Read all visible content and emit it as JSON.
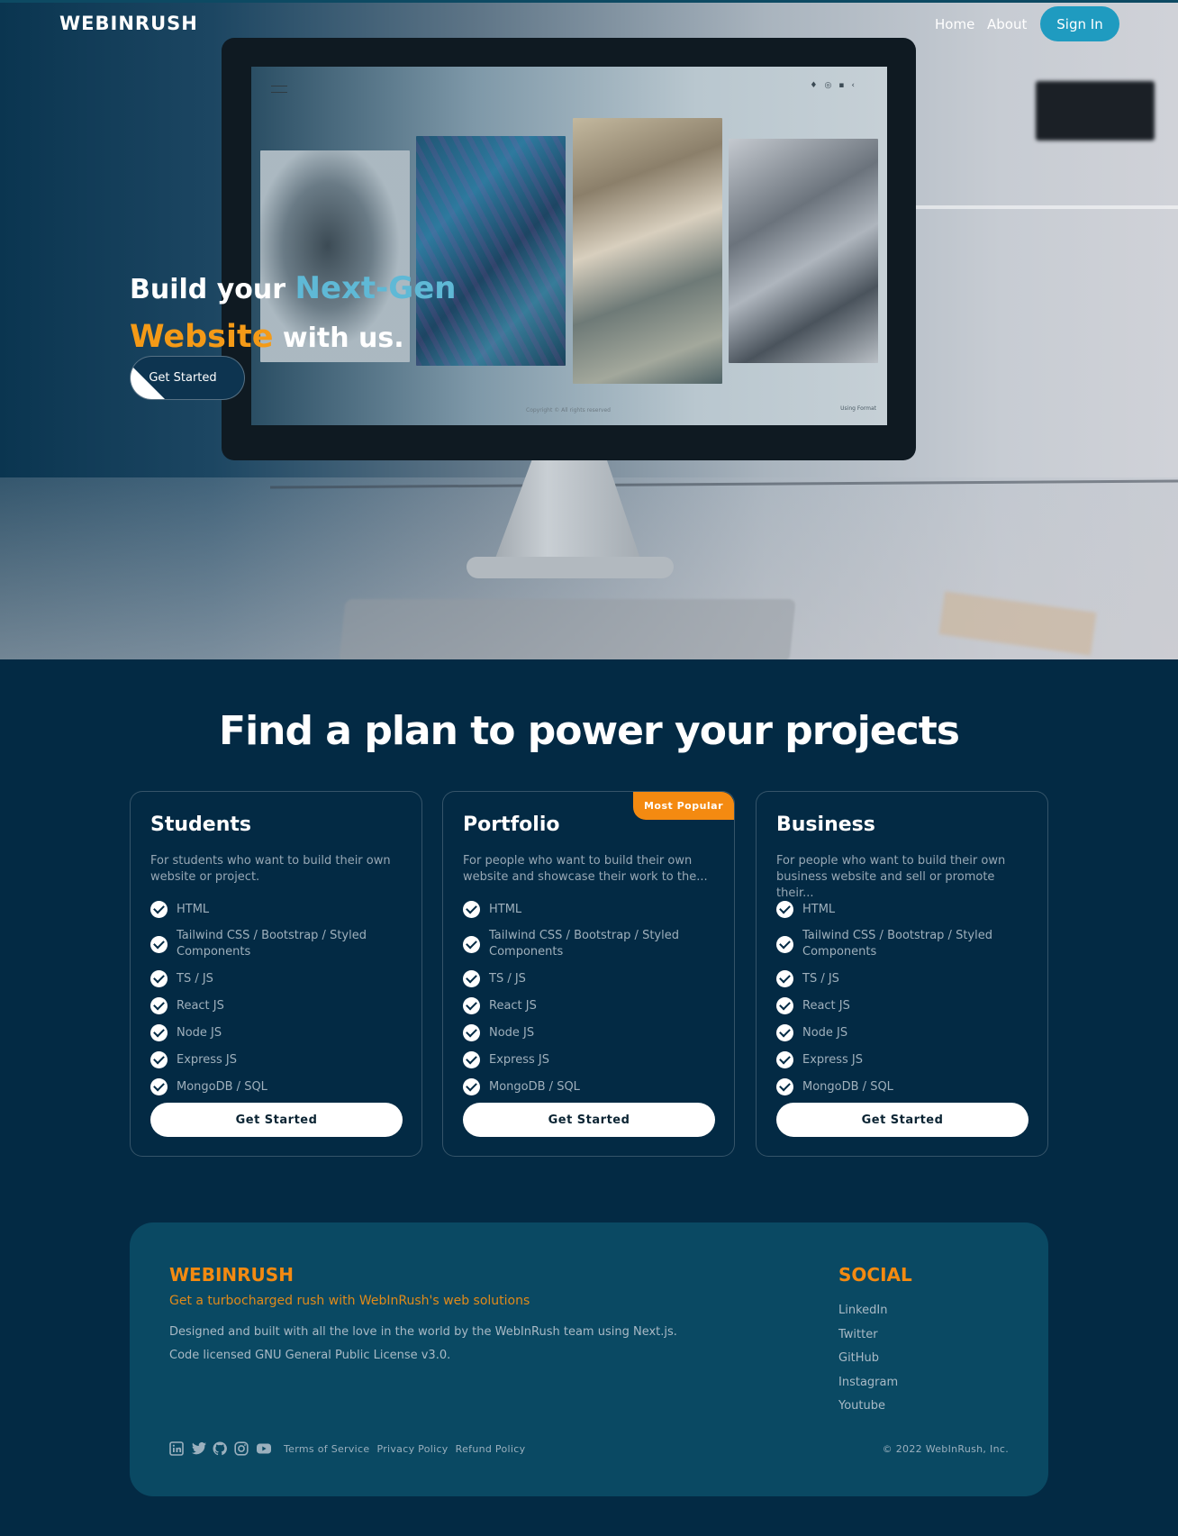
{
  "nav": {
    "logo": "WEBINRUSH",
    "links": [
      "Home",
      "About"
    ],
    "signin": "Sign In"
  },
  "hero": {
    "line1_a": "Build your ",
    "line1_b": "Next-Gen",
    "line2_a": "Website",
    "line2_b": " with us.",
    "cta": "Get Started",
    "screen_copy": "Copyright © All rights reserved",
    "screen_using": "Using Format"
  },
  "plans": {
    "title": "Find a plan to power your projects",
    "badge": "Most Popular",
    "cards": [
      {
        "name": "Students",
        "desc": "For students who want to build their own website or project.",
        "features": [
          "HTML",
          "Tailwind CSS / Bootstrap / Styled Components",
          "TS / JS",
          "React JS",
          "Node JS",
          "Express JS",
          "MongoDB / SQL"
        ],
        "button": "Get Started"
      },
      {
        "name": "Portfolio",
        "desc": "For people who want to build their own website and showcase their work to the...",
        "features": [
          "HTML",
          "Tailwind CSS / Bootstrap / Styled Components",
          "TS / JS",
          "React JS",
          "Node JS",
          "Express JS",
          "MongoDB / SQL"
        ],
        "button": "Get Started"
      },
      {
        "name": "Business",
        "desc": "For people who want to build their own business website and sell or promote their...",
        "features": [
          "HTML",
          "Tailwind CSS / Bootstrap / Styled Components",
          "TS / JS",
          "React JS",
          "Node JS",
          "Express JS",
          "MongoDB / SQL"
        ],
        "button": "Get Started"
      }
    ]
  },
  "footer": {
    "logo": "WEBINRUSH",
    "tagline": "Get a turbocharged rush with WebInRush's web solutions",
    "line1": "Designed and built with all the love in the world by the WebInRush team using Next.js.",
    "line2": "Code licensed GNU General Public License v3.0.",
    "social_title": "SOCIAL",
    "social_links": [
      "LinkedIn",
      "Twitter",
      "GitHub",
      "Instagram",
      "Youtube"
    ],
    "icons": [
      "linkedin-icon",
      "twitter-icon",
      "github-icon",
      "instagram-icon",
      "youtube-icon"
    ],
    "bottom_links": [
      "Terms of Service",
      "Privacy Policy",
      "Refund Policy"
    ],
    "copyright": "© 2022 WebInRush, Inc."
  },
  "colors": {
    "background": "#032a44",
    "accent_orange": "#f48a11",
    "accent_blue": "#1f9bc0",
    "footer_bg": "#0a4963"
  }
}
